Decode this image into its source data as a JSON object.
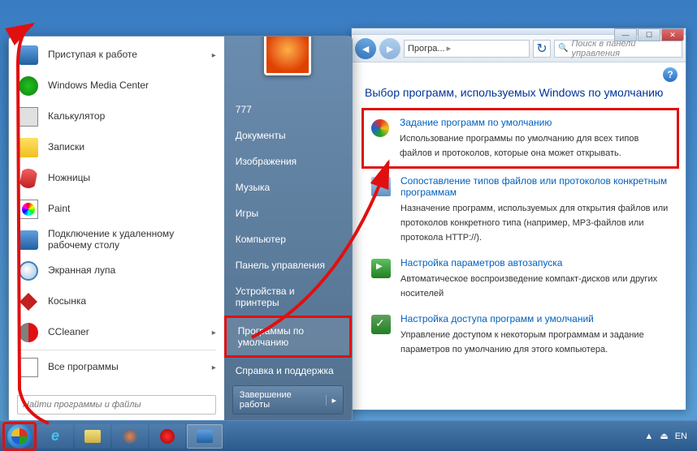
{
  "explorer": {
    "breadcrumb": {
      "seg1": "Програ...",
      "sep": "▸"
    },
    "search_placeholder": "Поиск в панели управления",
    "help": "?",
    "page_title": "Выбор программ, используемых Windows по умолчанию",
    "options": [
      {
        "link": "Задание программ по умолчанию",
        "desc": "Использование программы по умолчанию для всех типов файлов и протоколов, которые она может открывать.",
        "icon": "defprog",
        "highlighted": true
      },
      {
        "link": "Сопоставление типов файлов или протоколов конкретным программам",
        "desc": "Назначение программ, используемых для открытия файлов или протоколов конкретного типа (например, MP3-файлов или протокола HTTP://).",
        "icon": "assoc",
        "highlighted": false
      },
      {
        "link": "Настройка параметров автозапуска",
        "desc": "Автоматическое воспроизведение компакт-дисков или других носителей",
        "icon": "autoplay",
        "highlighted": false
      },
      {
        "link": "Настройка доступа программ и умолчаний",
        "desc": "Управление доступом к некоторым программам и задание параметров по умолчанию для этого компьютера.",
        "icon": "access",
        "highlighted": false
      }
    ]
  },
  "start_menu": {
    "left_items": [
      {
        "label": "Приступая к работе",
        "icon": "getting",
        "arrow": true
      },
      {
        "label": "Windows Media Center",
        "icon": "wmc"
      },
      {
        "label": "Калькулятор",
        "icon": "calc"
      },
      {
        "label": "Записки",
        "icon": "notes"
      },
      {
        "label": "Ножницы",
        "icon": "snip"
      },
      {
        "label": "Paint",
        "icon": "paint"
      },
      {
        "label": "Подключение к удаленному рабочему столу",
        "icon": "rdp"
      },
      {
        "label": "Экранная лупа",
        "icon": "magnifier"
      },
      {
        "label": "Косынка",
        "icon": "spider"
      },
      {
        "label": "CCleaner",
        "icon": "ccleaner",
        "arrow": true
      }
    ],
    "all_programs": "Все программы",
    "search_placeholder": "Найти программы и файлы",
    "right_items": [
      {
        "label": "777"
      },
      {
        "label": "Документы"
      },
      {
        "label": "Изображения"
      },
      {
        "label": "Музыка"
      },
      {
        "label": "Игры"
      },
      {
        "label": "Компьютер"
      },
      {
        "label": "Панель управления"
      },
      {
        "label": "Устройства и принтеры"
      },
      {
        "label": "Программы по умолчанию",
        "highlighted": true
      },
      {
        "label": "Справка и поддержка"
      }
    ],
    "shutdown": "Завершение работы",
    "shutdown_arrow": "▸"
  },
  "taskbar": {
    "lang": "EN",
    "tray_arrow": "▲",
    "safe_remove": "⏏"
  },
  "win_controls": {
    "min": "—",
    "max": "☐",
    "close": "✕"
  }
}
